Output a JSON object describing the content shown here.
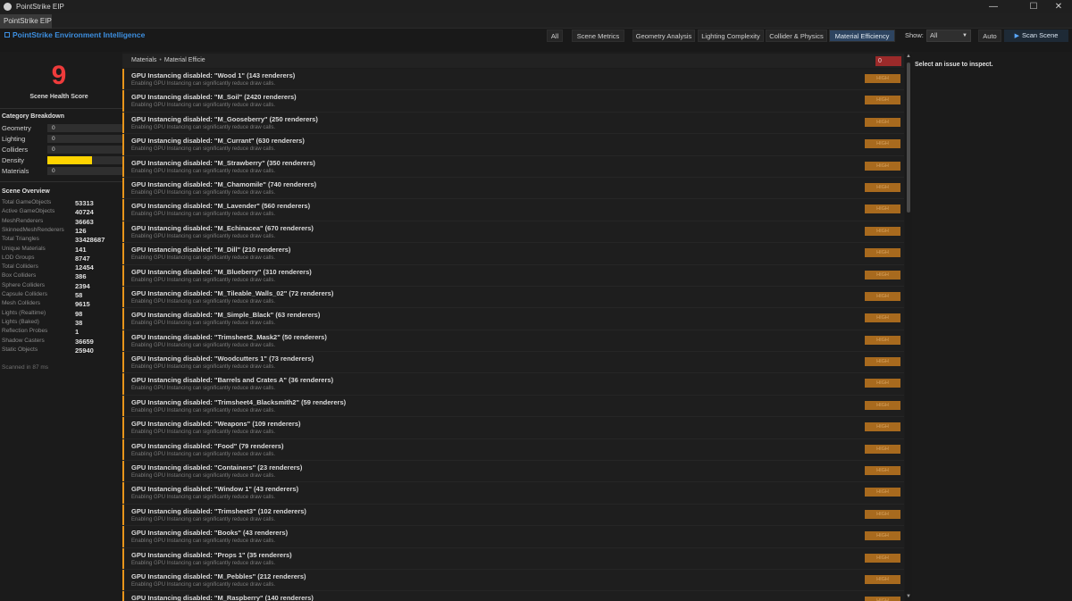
{
  "window": {
    "title": "PointStrike EIP",
    "minimize": "—",
    "maximize": "☐",
    "close": "✕"
  },
  "tab": {
    "label": "PointStrike EIP"
  },
  "brand": {
    "label": "PointStrike  Environment Intelligence"
  },
  "filters": [
    {
      "label": "All",
      "active": false
    },
    {
      "label": "Scene Metrics",
      "active": false
    },
    {
      "label": "Geometry Analysis",
      "active": false
    },
    {
      "label": "Lighting Complexity",
      "active": false
    },
    {
      "label": "Collider & Physics",
      "active": false
    },
    {
      "label": "Material Efficiency",
      "active": true
    }
  ],
  "show": {
    "label": "Show:",
    "value": "All"
  },
  "auto_label": "Auto",
  "scan_label": "Scan Scene",
  "health": {
    "score": "9",
    "label": "Scene Health Score"
  },
  "category_breakdown": {
    "title": "Category Breakdown",
    "items": [
      {
        "label": "Geometry",
        "value": "0",
        "fill": 0
      },
      {
        "label": "Lighting",
        "value": "0",
        "fill": 0
      },
      {
        "label": "Colliders",
        "value": "0",
        "fill": 0
      },
      {
        "label": "Density",
        "value": "",
        "fill": 0.6
      },
      {
        "label": "Materials",
        "value": "0",
        "fill": 0
      }
    ]
  },
  "overview": {
    "title": "Scene Overview",
    "rows": [
      {
        "k": "Total GameObjects",
        "v": "53313"
      },
      {
        "k": "Active GameObjects",
        "v": "40724"
      },
      {
        "k": "MeshRenderers",
        "v": "36663"
      },
      {
        "k": "SkinnedMeshRenderers",
        "v": "126"
      },
      {
        "k": "Total Triangles",
        "v": "33428687"
      },
      {
        "k": "Unique Materials",
        "v": "141"
      },
      {
        "k": "LOD Groups",
        "v": "8747"
      },
      {
        "k": "Total Colliders",
        "v": "12454"
      },
      {
        "k": "Box Colliders",
        "v": "386"
      },
      {
        "k": "Sphere Colliders",
        "v": "2394"
      },
      {
        "k": "Capsule Colliders",
        "v": "58"
      },
      {
        "k": "Mesh Colliders",
        "v": "9615"
      },
      {
        "k": "Lights (Realtime)",
        "v": "98"
      },
      {
        "k": "Lights (Baked)",
        "v": "38"
      },
      {
        "k": "Reflection Probes",
        "v": "1"
      },
      {
        "k": "Shadow Casters",
        "v": "36659"
      },
      {
        "k": "Static Objects",
        "v": "25940"
      }
    ],
    "scanned": "Scanned in 87 ms"
  },
  "breadcrumb": {
    "root": "Materials",
    "current": "Material Efficie",
    "count": "0"
  },
  "issue_desc": "Enabling GPU Instancing can significantly reduce draw calls.",
  "severity_label": "HIGH",
  "issues": [
    "GPU Instancing disabled: \"Wood 1\" (143 renderers)",
    "GPU Instancing disabled: \"M_Soil\" (2420 renderers)",
    "GPU Instancing disabled: \"M_Gooseberry\" (250 renderers)",
    "GPU Instancing disabled: \"M_Currant\" (630 renderers)",
    "GPU Instancing disabled: \"M_Strawberry\" (350 renderers)",
    "GPU Instancing disabled: \"M_Chamomile\" (740 renderers)",
    "GPU Instancing disabled: \"M_Lavender\" (560 renderers)",
    "GPU Instancing disabled: \"M_Echinacea\" (670 renderers)",
    "GPU Instancing disabled: \"M_Dill\" (210 renderers)",
    "GPU Instancing disabled: \"M_Blueberry\" (310 renderers)",
    "GPU Instancing disabled: \"M_Tileable_Walls_02\" (72 renderers)",
    "GPU Instancing disabled: \"M_Simple_Black\" (63 renderers)",
    "GPU Instancing disabled: \"Trimsheet2_Mask2\" (50 renderers)",
    "GPU Instancing disabled: \"Woodcutters 1\" (73 renderers)",
    "GPU Instancing disabled: \"Barrels and Crates A\" (36 renderers)",
    "GPU Instancing disabled: \"Trimsheet4_Blacksmith2\" (59 renderers)",
    "GPU Instancing disabled: \"Weapons\" (109 renderers)",
    "GPU Instancing disabled: \"Food\" (79 renderers)",
    "GPU Instancing disabled: \"Containers\" (23 renderers)",
    "GPU Instancing disabled: \"Window 1\" (43 renderers)",
    "GPU Instancing disabled: \"Trimsheet3\" (102 renderers)",
    "GPU Instancing disabled: \"Books\" (43 renderers)",
    "GPU Instancing disabled: \"Props 1\" (35 renderers)",
    "GPU Instancing disabled: \"M_Pebbles\" (212 renderers)",
    "GPU Instancing disabled: \"M_Raspberry\" (140 renderers)"
  ],
  "inspector": {
    "hint": "Select an issue to inspect."
  },
  "colors": {
    "accent": "#3d8fe0",
    "score": "#ee3b3b",
    "density": "#ffd400",
    "issue_accent": "#e8951b",
    "severity": "#a86a1e"
  }
}
